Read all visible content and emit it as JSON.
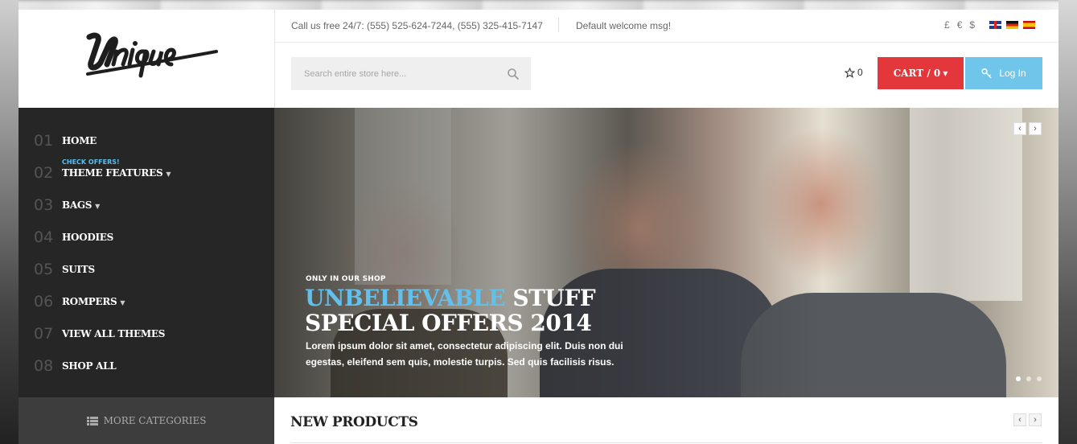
{
  "topbar": {
    "phone": "Call us free 24/7: (555) 525-624-7244, (555) 325-415-7147",
    "welcome": "Default welcome msg!",
    "currencies": [
      "£",
      "€",
      "$"
    ],
    "languages": [
      "English",
      "German",
      "Spanish"
    ]
  },
  "logo": {
    "text": "Unique"
  },
  "search": {
    "placeholder": "Search entire store here..."
  },
  "header": {
    "wishlist_count": "0",
    "cart_label": "CART / 0",
    "login_label": "Log In"
  },
  "nav": {
    "items": [
      {
        "num": "01",
        "label": "HOME"
      },
      {
        "num": "02",
        "label": "THEME FEATURES",
        "badge": "CHECK OFFERS!",
        "dropdown": true
      },
      {
        "num": "03",
        "label": "BAGS",
        "dropdown": true
      },
      {
        "num": "04",
        "label": "HOODIES"
      },
      {
        "num": "05",
        "label": "SUITS"
      },
      {
        "num": "06",
        "label": "ROMPERS",
        "dropdown": true
      },
      {
        "num": "07",
        "label": "VIEW ALL THEMES"
      },
      {
        "num": "08",
        "label": "SHOP ALL"
      }
    ],
    "more_categories": "MORE CATEGORIES"
  },
  "hero": {
    "eyebrow": "ONLY IN OUR SHOP",
    "headline_accent": "UNBELIEVABLE",
    "headline_rest": " STUFF",
    "headline2": "SPECIAL OFFERS 2014",
    "description": "Lorem ipsum dolor sit amet, consectetur adipiscing elit. Duis non dui egestas, eleifend sem quis, molestie turpis. Sed quis facilisis risus.",
    "slide_count": 3,
    "active_slide": 1
  },
  "sections": {
    "new_products": "NEW PRODUCTS"
  },
  "colors": {
    "accent_blue": "#62c1ec",
    "cart_red": "#e3373b",
    "login_blue": "#6fc5ea",
    "nav_bg": "#262626"
  }
}
